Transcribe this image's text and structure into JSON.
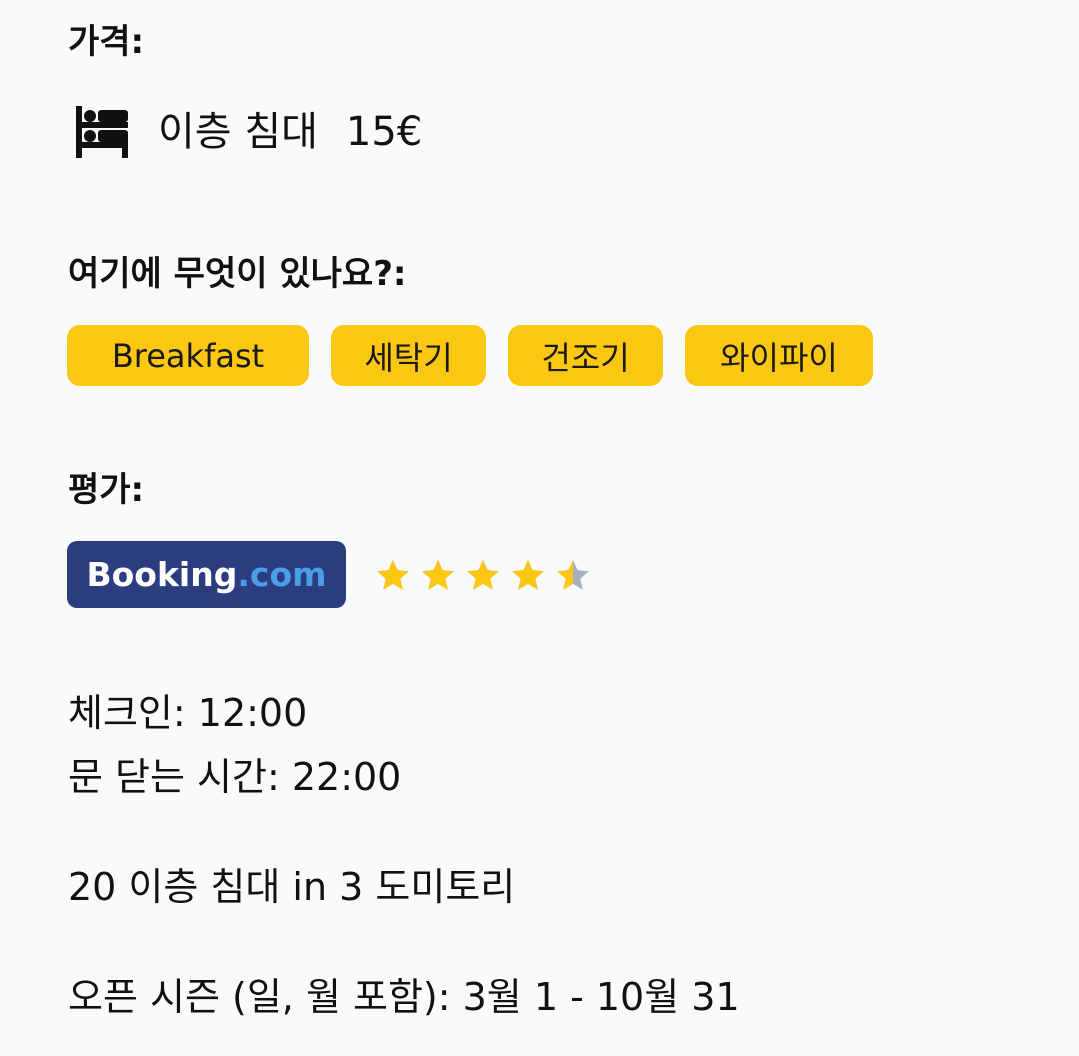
{
  "price": {
    "heading": "가격:",
    "icon": "bed-icon",
    "label": "이층 침대",
    "value": "15€"
  },
  "amenities": {
    "heading": "여기에 무엇이 있나요?:",
    "tags": [
      "Breakfast",
      "세탁기",
      "건조기",
      "와이파이"
    ],
    "tag_color": "#fcc712"
  },
  "rating": {
    "heading": "평가:",
    "provider_name": "Booking",
    "provider_suffix": ".com",
    "badge_color": "#2b3c7f",
    "stars": 4.5,
    "max_stars": 5,
    "star_color": "#fcc712",
    "star_empty_color": "#a8b0bf"
  },
  "info": {
    "checkin": "체크인: 12:00",
    "curfew": "문 닫는 시간: 22:00",
    "beds": "20 이층 침대 in 3 도미토리",
    "season": "오픈 시즌 (일, 월 포함): 3월 1 - 10월 31"
  }
}
